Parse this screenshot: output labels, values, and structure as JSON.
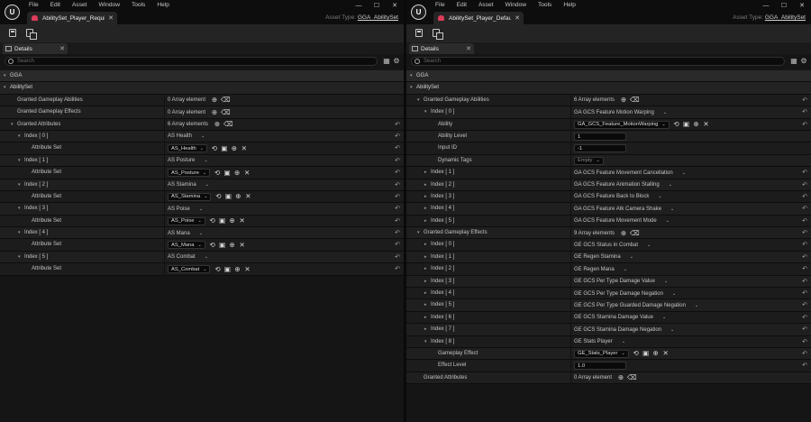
{
  "menu": [
    "File",
    "Edit",
    "Asset",
    "Window",
    "Tools",
    "Help"
  ],
  "window_controls": {
    "minimize": "—",
    "maximize": "☐",
    "close": "✕"
  },
  "logo_text": "U",
  "panel_tab_label": "Details",
  "search_placeholder": "Search",
  "asset_type_label": "Asset Type:",
  "asset_type_value": "GGA_AbilitySet",
  "left": {
    "tab_title": "AbilitySet_Player_Requir...",
    "rows": [
      {
        "kind": "cat",
        "indent": 0,
        "arrow": "▾",
        "label": "GGA"
      },
      {
        "kind": "sub",
        "indent": 0,
        "arrow": "▾",
        "label": "AbilitySet"
      },
      {
        "kind": "prop",
        "indent": 1,
        "label": "Granted Gameplay Abilities",
        "value": {
          "type": "text",
          "text": "0 Array element",
          "icons": [
            "⊕",
            "🗑"
          ]
        }
      },
      {
        "kind": "prop",
        "indent": 1,
        "label": "Granted Gameplay Effects",
        "value": {
          "type": "text",
          "text": "0 Array element",
          "icons": [
            "⊕",
            "🗑"
          ]
        }
      },
      {
        "kind": "prop",
        "indent": 1,
        "arrow": "▾",
        "label": "Granted Attributes",
        "value": {
          "type": "text",
          "text": "6 Array elements",
          "icons": [
            "⊕",
            "🗑"
          ]
        },
        "reset": true
      },
      {
        "kind": "prop",
        "indent": 2,
        "arrow": "▾",
        "label": "Index [ 0 ]",
        "value": {
          "type": "text",
          "text": "AS Health",
          "dropdown": true
        },
        "reset": true
      },
      {
        "kind": "prop",
        "indent": 3,
        "label": "Attribute Set",
        "value": {
          "type": "combo",
          "text": "AS_Health",
          "icons": [
            "⟲",
            "▣",
            "⊕",
            "✕"
          ]
        },
        "reset": true
      },
      {
        "kind": "prop",
        "indent": 2,
        "arrow": "▾",
        "label": "Index [ 1 ]",
        "value": {
          "type": "text",
          "text": "AS Posture",
          "dropdown": true
        },
        "reset": true
      },
      {
        "kind": "prop",
        "indent": 3,
        "label": "Attribute Set",
        "value": {
          "type": "combo",
          "text": "AS_Posture",
          "icons": [
            "⟲",
            "▣",
            "⊕",
            "✕"
          ]
        },
        "reset": true
      },
      {
        "kind": "prop",
        "indent": 2,
        "arrow": "▾",
        "label": "Index [ 2 ]",
        "value": {
          "type": "text",
          "text": "AS Stamina",
          "dropdown": true
        },
        "reset": true
      },
      {
        "kind": "prop",
        "indent": 3,
        "label": "Attribute Set",
        "value": {
          "type": "combo",
          "text": "AS_Stamina",
          "icons": [
            "⟲",
            "▣",
            "⊕",
            "✕"
          ]
        },
        "reset": true
      },
      {
        "kind": "prop",
        "indent": 2,
        "arrow": "▾",
        "label": "Index [ 3 ]",
        "value": {
          "type": "text",
          "text": "AS Poise",
          "dropdown": true
        },
        "reset": true
      },
      {
        "kind": "prop",
        "indent": 3,
        "label": "Attribute Set",
        "value": {
          "type": "combo",
          "text": "AS_Poise",
          "icons": [
            "⟲",
            "▣",
            "⊕",
            "✕"
          ]
        },
        "reset": true
      },
      {
        "kind": "prop",
        "indent": 2,
        "arrow": "▾",
        "label": "Index [ 4 ]",
        "value": {
          "type": "text",
          "text": "AS Mana",
          "dropdown": true
        },
        "reset": true
      },
      {
        "kind": "prop",
        "indent": 3,
        "label": "Attribute Set",
        "value": {
          "type": "combo",
          "text": "AS_Mana",
          "icons": [
            "⟲",
            "▣",
            "⊕",
            "✕"
          ]
        },
        "reset": true
      },
      {
        "kind": "prop",
        "indent": 2,
        "arrow": "▾",
        "label": "Index [ 5 ]",
        "value": {
          "type": "text",
          "text": "AS Combat",
          "dropdown": true
        },
        "reset": true
      },
      {
        "kind": "prop",
        "indent": 3,
        "label": "Attribute Set",
        "value": {
          "type": "combo",
          "text": "AS_Combat",
          "icons": [
            "⟲",
            "▣",
            "⊕",
            "✕"
          ]
        },
        "reset": true
      }
    ]
  },
  "right": {
    "tab_title": "AbilitySet_Player_Defaults",
    "rows": [
      {
        "kind": "cat",
        "indent": 0,
        "arrow": "▾",
        "label": "GGA"
      },
      {
        "kind": "sub",
        "indent": 0,
        "arrow": "▾",
        "label": "AbilitySet"
      },
      {
        "kind": "prop",
        "indent": 1,
        "arrow": "▾",
        "label": "Granted Gameplay Abilities",
        "value": {
          "type": "text",
          "text": "6 Array elements",
          "icons": [
            "⊕",
            "🗑"
          ]
        },
        "reset": true
      },
      {
        "kind": "prop",
        "indent": 2,
        "arrow": "▾",
        "label": "Index [ 0 ]",
        "value": {
          "type": "text",
          "text": "GA GCS Feature Motion Warping",
          "dropdown": true
        },
        "reset": true
      },
      {
        "kind": "prop",
        "indent": 3,
        "label": "Ability",
        "value": {
          "type": "combo",
          "text": "GA_GCS_Feature_MotionWarping",
          "icons": [
            "⟲",
            "▣",
            "⊕",
            "✕"
          ]
        },
        "reset": true
      },
      {
        "kind": "prop",
        "indent": 3,
        "label": "Ability Level",
        "value": {
          "type": "input",
          "text": "1"
        }
      },
      {
        "kind": "prop",
        "indent": 3,
        "label": "Input ID",
        "value": {
          "type": "input",
          "text": "-1"
        }
      },
      {
        "kind": "prop",
        "indent": 3,
        "label": "Dynamic Tags",
        "value": {
          "type": "combo",
          "text": "Empty",
          "muted": true
        }
      },
      {
        "kind": "prop",
        "indent": 2,
        "arrow": "▸",
        "label": "Index [ 1 ]",
        "value": {
          "type": "text",
          "text": "GA GCS Feature Movement Cancellation",
          "dropdown": true
        },
        "reset": true
      },
      {
        "kind": "prop",
        "indent": 2,
        "arrow": "▸",
        "label": "Index [ 2 ]",
        "value": {
          "type": "text",
          "text": "GA GCS Feature Animation Stalling",
          "dropdown": true
        },
        "reset": true
      },
      {
        "kind": "prop",
        "indent": 2,
        "arrow": "▸",
        "label": "Index [ 3 ]",
        "value": {
          "type": "text",
          "text": "GA GCS Feature Back to Block",
          "dropdown": true
        },
        "reset": true
      },
      {
        "kind": "prop",
        "indent": 2,
        "arrow": "▸",
        "label": "Index [ 4 ]",
        "value": {
          "type": "text",
          "text": "GA GCS Feature Atk Camera Shake",
          "dropdown": true
        },
        "reset": true
      },
      {
        "kind": "prop",
        "indent": 2,
        "arrow": "▸",
        "label": "Index [ 5 ]",
        "value": {
          "type": "text",
          "text": "GA GCS Feature Movement Mode",
          "dropdown": true
        },
        "reset": true
      },
      {
        "kind": "prop",
        "indent": 1,
        "arrow": "▾",
        "label": "Granted Gameplay Effects",
        "value": {
          "type": "text",
          "text": "9 Array elements",
          "icons": [
            "⊕",
            "🗑"
          ]
        },
        "reset": true
      },
      {
        "kind": "prop",
        "indent": 2,
        "arrow": "▸",
        "label": "Index [ 0 ]",
        "value": {
          "type": "text",
          "text": "GE GCS Status in Combat",
          "dropdown": true
        },
        "reset": true
      },
      {
        "kind": "prop",
        "indent": 2,
        "arrow": "▸",
        "label": "Index [ 1 ]",
        "value": {
          "type": "text",
          "text": "GE Regen Stamina",
          "dropdown": true
        },
        "reset": true
      },
      {
        "kind": "prop",
        "indent": 2,
        "arrow": "▸",
        "label": "Index [ 2 ]",
        "value": {
          "type": "text",
          "text": "GE Regen Mana",
          "dropdown": true
        },
        "reset": true
      },
      {
        "kind": "prop",
        "indent": 2,
        "arrow": "▸",
        "label": "Index [ 3 ]",
        "value": {
          "type": "text",
          "text": "GE GCS Per Type Damage Value",
          "dropdown": true
        },
        "reset": true
      },
      {
        "kind": "prop",
        "indent": 2,
        "arrow": "▸",
        "label": "Index [ 4 ]",
        "value": {
          "type": "text",
          "text": "GE GCS Per Type Damage Negation",
          "dropdown": true
        },
        "reset": true
      },
      {
        "kind": "prop",
        "indent": 2,
        "arrow": "▸",
        "label": "Index [ 5 ]",
        "value": {
          "type": "text",
          "text": "GE GCS Per Type Guarded Damage Negation",
          "dropdown": true
        },
        "reset": true
      },
      {
        "kind": "prop",
        "indent": 2,
        "arrow": "▸",
        "label": "Index [ 6 ]",
        "value": {
          "type": "text",
          "text": "GE GCS Stamina Damage Value",
          "dropdown": true
        },
        "reset": true
      },
      {
        "kind": "prop",
        "indent": 2,
        "arrow": "▸",
        "label": "Index [ 7 ]",
        "value": {
          "type": "text",
          "text": "GE GCS Stamina Damage Negation",
          "dropdown": true
        },
        "reset": true
      },
      {
        "kind": "prop",
        "indent": 2,
        "arrow": "▾",
        "label": "Index [ 8 ]",
        "value": {
          "type": "text",
          "text": "GE Stats Player",
          "dropdown": true
        },
        "reset": true
      },
      {
        "kind": "prop",
        "indent": 3,
        "label": "Gameplay Effect",
        "value": {
          "type": "combo",
          "text": "GE_Stats_Player",
          "icons": [
            "⟲",
            "▣",
            "⊕",
            "✕"
          ]
        },
        "reset": true
      },
      {
        "kind": "prop",
        "indent": 3,
        "label": "Effect Level",
        "value": {
          "type": "input",
          "text": "1.0"
        },
        "reset": true
      },
      {
        "kind": "prop",
        "indent": 1,
        "label": "Granted Attributes",
        "value": {
          "type": "text",
          "text": "0 Array element",
          "icons": [
            "⊕",
            "🗑"
          ]
        }
      }
    ]
  }
}
